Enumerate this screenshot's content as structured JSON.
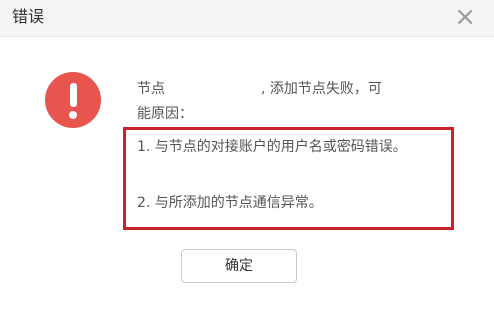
{
  "dialog": {
    "title": "错误",
    "close_symbol": "×",
    "icon": "error-icon",
    "message": {
      "prefix": "节点",
      "suffix": ", 添加节点失败，可",
      "line2": "能原因："
    },
    "reasons": [
      "1. 与节点的对接账户的用户名或密码错误。",
      "2. 与所添加的节点通信异常。"
    ],
    "ok_label": "确定",
    "colors": {
      "error_icon": "#e8554e",
      "highlight_border": "#c8222c"
    }
  }
}
